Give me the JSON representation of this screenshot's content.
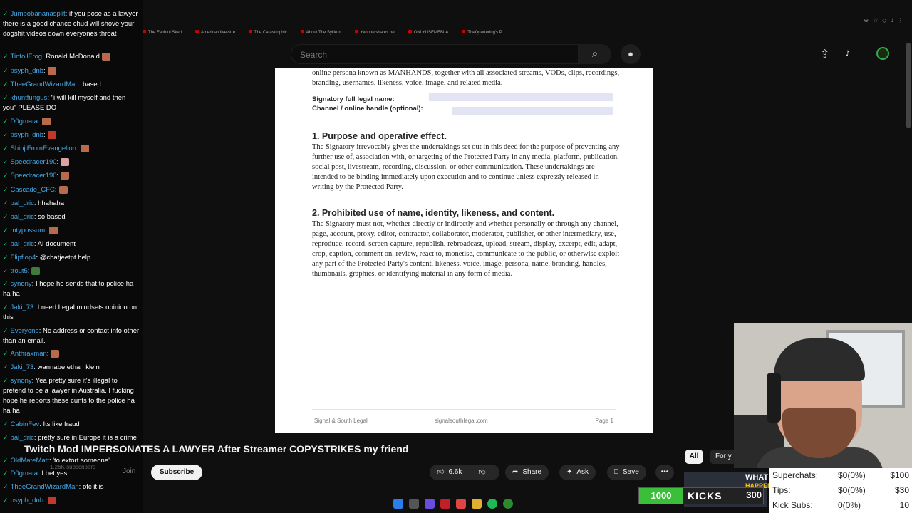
{
  "browser": {
    "bookmarks": [
      "The Faithful Skeri...",
      "American live-stre...",
      "The Catastrophic...",
      "About The Sykkun...",
      "Yvonne shares he...",
      "ONLYUSEMEBLA...",
      "TheQuartering's P..."
    ]
  },
  "youtube": {
    "search_placeholder": "Search",
    "video_title": "Twitch Mod IMPERSONATES A LAWYER After Streamer COPYSTRIKES my friend",
    "subscribers": "1.26K subscribers",
    "join_label": "Join",
    "subscribe_label": "Subscribe",
    "likes": "6.6k",
    "share_label": "Share",
    "ask_label": "Ask",
    "save_label": "Save",
    "chip_all": "All",
    "chip_for_you": "For y",
    "thumb_text_1": "WHAT",
    "thumb_text_2": "HAPPENED"
  },
  "document": {
    "intro": "online persona known as MANHANDS, together with all associated streams, VODs, clips, recordings, branding, usernames, likeness, voice, image, and related media.",
    "signatory_label": "Signatory full legal name:",
    "channel_label": "Channel / online handle (optional):",
    "section1_heading": "1. Purpose and operative effect.",
    "section1_body": "The Signatory irrevocably gives the undertakings set out in this deed for the purpose of preventing any further use of, association with, or targeting of the Protected Party in any media, platform, publication, social post, livestream, recording, discussion, or other communication. These undertakings are intended to be binding immediately upon execution and to continue unless expressly released in writing by the Protected Party.",
    "section2_heading": "2. Prohibited use of name, identity, likeness, and content.",
    "section2_body": "The Signatory must not, whether directly or indirectly and whether personally or through any channel, page, account, proxy, editor, contractor, collaborator, moderator, publisher, or other intermediary, use, reproduce, record, screen-capture, republish, rebroadcast, upload, stream, display, excerpt, edit, adapt, crop, caption, comment on, review, react to, monetise, communicate to the public, or otherwise exploit any part of the Protected Party's content, likeness, voice, image, persona, name, branding, handles, thumbnails, graphics, or identifying material in any form of media.",
    "footer_left": "Signal & South Legal",
    "footer_center": "signalsouthlegal.com",
    "footer_right": "Page 1"
  },
  "chat": [
    {
      "user": "Jumbobananasplit",
      "text": "if you pose as a lawyer there is a good chance chud will shove your dogshit videos down everyones throat",
      "emote": ""
    },
    {
      "user": "TinfoilFrog",
      "text": "Ronald McDonald",
      "emote": "brown"
    },
    {
      "user": "psyph_dnb",
      "text": "",
      "emote": "brown"
    },
    {
      "user": "TheeGrandWizardMan",
      "text": "based",
      "emote": ""
    },
    {
      "user": "khuntfungus",
      "text": "\"i will kill myself and then you\" PLEASE DO",
      "emote": ""
    },
    {
      "user": "D0gmata",
      "text": "",
      "emote": "brown"
    },
    {
      "user": "psyph_dnb",
      "text": "",
      "emote": "red"
    },
    {
      "user": "ShinjiFromEvangelion",
      "text": "",
      "emote": "brown"
    },
    {
      "user": "Speedracer190",
      "text": "",
      "emote": "pink"
    },
    {
      "user": "Speedracer190",
      "text": "",
      "emote": "brown"
    },
    {
      "user": "Cascade_CFC",
      "text": "",
      "emote": "brown"
    },
    {
      "user": "bal_dric",
      "text": "hhahaha",
      "emote": ""
    },
    {
      "user": "bal_dric",
      "text": "so based",
      "emote": ""
    },
    {
      "user": "mtypossum",
      "text": "",
      "emote": "brown"
    },
    {
      "user": "bal_dric",
      "text": "AI document",
      "emote": ""
    },
    {
      "user": "Flipflop4",
      "text": "@chatjeetpt help",
      "emote": ""
    },
    {
      "user": "trout5",
      "text": "",
      "emote": "green"
    },
    {
      "user": "synony",
      "text": "I hope he sends that to police ha ha ha",
      "emote": ""
    },
    {
      "user": "Jaki_73",
      "text": "I need Legal mindsets opinion on this",
      "emote": ""
    },
    {
      "user": "Everyone",
      "text": "No address or contact info other than an email.",
      "emote": ""
    },
    {
      "user": "Anthraxman",
      "text": "",
      "emote": "brown"
    },
    {
      "user": "Jaki_73",
      "text": "wannabe ethan klein",
      "emote": ""
    },
    {
      "user": "synony",
      "text": "Yea pretty sure it's illegal to pretend to be a lawyer in Australia. I fucking hope he reports these cunts to the police ha ha ha",
      "emote": ""
    },
    {
      "user": "CabinFev",
      "text": "Its like fraud",
      "emote": ""
    },
    {
      "user": "bal_dric",
      "text": "pretty sure in Europe it is a crime",
      "emote": ""
    },
    {
      "user": "OldMateMatt",
      "text": "'to extort someone'",
      "emote": ""
    },
    {
      "user": "D0gmata",
      "text": "I bet yes",
      "emote": ""
    },
    {
      "user": "TheeGrandWizardMan",
      "text": "ofc it is",
      "emote": ""
    },
    {
      "user": "psyph_dnb",
      "text": "",
      "emote": "red"
    }
  ],
  "kicks": {
    "count": "1000",
    "label": "KICKS",
    "goal": "300"
  },
  "stats": [
    {
      "label": "Superchats:",
      "value": "$0(0%)",
      "goal": "$100"
    },
    {
      "label": "Tips:",
      "value": "$0(0%)",
      "goal": "$30"
    },
    {
      "label": "Kick Subs:",
      "value": "0(0%)",
      "goal": "10"
    }
  ]
}
